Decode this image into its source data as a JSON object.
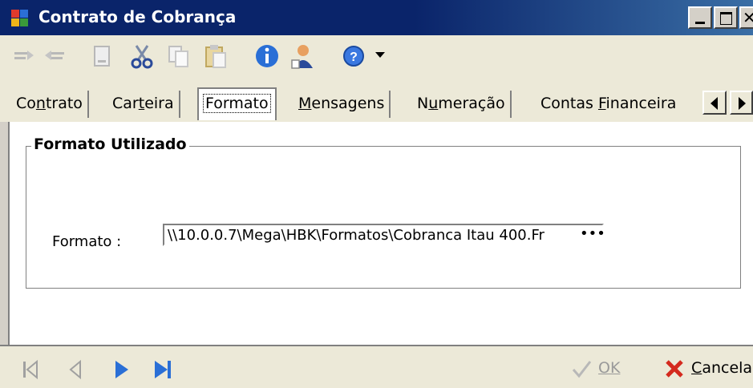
{
  "window": {
    "title": "Contrato de Cobrança",
    "close_glyph": "✕"
  },
  "toolbar": {
    "icons": [
      "sort-asc-icon",
      "sort-desc-icon",
      "new-document-icon",
      "cut-icon",
      "copy-icon",
      "paste-icon",
      "info-icon",
      "user-icon",
      "help-icon",
      "dropdown-arrow-icon"
    ]
  },
  "tabs": [
    {
      "pre": "Co",
      "u": "n",
      "post": "trato"
    },
    {
      "pre": "Car",
      "u": "t",
      "post": "eira"
    },
    {
      "pre": "Formato",
      "u": "",
      "post": ""
    },
    {
      "pre": "",
      "u": "M",
      "post": "ensagens"
    },
    {
      "pre": "N",
      "u": "u",
      "post": "meração"
    },
    {
      "pre": "Contas ",
      "u": "F",
      "post": "inanceira"
    }
  ],
  "group": {
    "title": "Formato Utilizado",
    "formato_label": "Formato :",
    "formato_value": "\\\\10.0.0.7\\Mega\\HBK\\Formatos\\Cobranca Itau 400.Fr",
    "ellipsis": "•••"
  },
  "bottom": {
    "ok_label": "OK",
    "cancel_label": "ancela",
    "cancel_underlined": "C"
  },
  "colors": {
    "title_bar": "#0a246a",
    "nav_blue": "#2a6fd6",
    "cancel_red": "#d42a1e"
  }
}
